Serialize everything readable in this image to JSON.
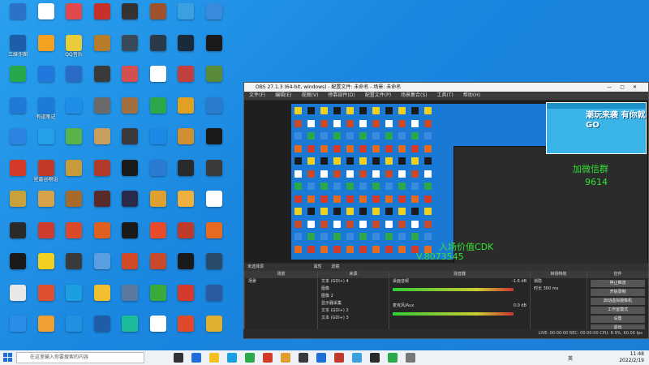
{
  "desktop": {
    "columns": [
      [
        [
          "",
          "#2b73c9"
        ],
        [
          "三维作图",
          "#1e5ea8"
        ],
        [
          "",
          "#27a84a"
        ],
        [
          "",
          "#1e7ad6"
        ],
        [
          "",
          "#2b84e0"
        ],
        [
          "",
          "#d43a2a"
        ],
        [
          "",
          "#c9a13a"
        ],
        [
          "",
          "#2a2a2a"
        ],
        [
          "",
          "#1a1a1a"
        ],
        [
          "",
          "#e8e8e8"
        ],
        [
          "",
          "#2b8ee6"
        ]
      ],
      [
        [
          "",
          "#ffffff"
        ],
        [
          "",
          "#f4a020"
        ],
        [
          "",
          "#2277dd"
        ],
        [
          "有道笔记",
          "#1c7cd5"
        ],
        [
          "",
          "#23a0e8"
        ],
        [
          "星露谷物语",
          "#c33a28"
        ],
        [
          "",
          "#d6a24a"
        ],
        [
          "",
          "#cf3b2c"
        ],
        [
          "",
          "#f2d020"
        ],
        [
          "",
          "#e05030"
        ],
        [
          "",
          "#f0a030"
        ]
      ],
      [
        [
          "",
          "#e0484c"
        ],
        [
          "QQ音乐",
          "#eacb3a"
        ],
        [
          "",
          "#2b6bc8"
        ],
        [
          "",
          "#1f8ee8"
        ],
        [
          "",
          "#5ab24a"
        ],
        [
          "",
          "#c89a3a"
        ],
        [
          "",
          "#a86a2a"
        ],
        [
          "",
          "#d94a2a"
        ],
        [
          "",
          "#3a3a3a"
        ],
        [
          "",
          "#1aa0e0"
        ],
        [
          "",
          "#2090e0"
        ]
      ],
      [
        [
          "",
          "#c8302a"
        ],
        [
          "",
          "#b67c2a"
        ],
        [
          "",
          "#3a3a3a"
        ],
        [
          "",
          "#6a6a6a"
        ],
        [
          "",
          "#c7a060"
        ],
        [
          "",
          "#b23a2a"
        ],
        [
          "",
          "#5a2a2a"
        ],
        [
          "",
          "#e06020"
        ],
        [
          "",
          "#5aa0e0"
        ],
        [
          "",
          "#f0c030"
        ],
        [
          "",
          "#1e5ea8"
        ]
      ],
      [
        [
          "",
          "#333"
        ],
        [
          "",
          "#3a4a5a"
        ],
        [
          "",
          "#d45050"
        ],
        [
          "",
          "#a07040"
        ],
        [
          "",
          "#3a3a3a"
        ],
        [
          "",
          "#1a1a1a"
        ],
        [
          "",
          "#2a2a4a"
        ],
        [
          "",
          "#1a1a1a"
        ],
        [
          "",
          "#d04a2a"
        ],
        [
          "",
          "#5a7aa0"
        ],
        [
          "",
          "#1abc9c"
        ]
      ],
      [
        [
          "",
          "#a0522d"
        ],
        [
          "",
          "#2a3a4a"
        ],
        [
          "",
          "#ffffff"
        ],
        [
          "",
          "#2aa84a"
        ],
        [
          "",
          "#1e88e5"
        ],
        [
          "",
          "#2a7ad0"
        ],
        [
          "",
          "#e0a030"
        ],
        [
          "",
          "#e84a2a"
        ],
        [
          "",
          "#c84a2a"
        ],
        [
          "",
          "#3aaa3a"
        ],
        [
          "",
          "#ffffff"
        ]
      ],
      [
        [
          "",
          "#3aa0e0"
        ],
        [
          "",
          "#1a2a3a"
        ],
        [
          "",
          "#c04040"
        ],
        [
          "",
          "#e0a020"
        ],
        [
          "",
          "#d09030"
        ],
        [
          "",
          "#2a2a2a"
        ],
        [
          "",
          "#f0b040"
        ],
        [
          "",
          "#c03a2a"
        ],
        [
          "",
          "#1a1a1a"
        ],
        [
          "",
          "#d63a2a"
        ],
        [
          "",
          "#e04a2a"
        ]
      ],
      [
        [
          "",
          "#3a8ae0"
        ],
        [
          "",
          "#1a1a1a"
        ],
        [
          "",
          "#5a8a3a"
        ],
        [
          "",
          "#2a7ad0"
        ],
        [
          "",
          "#1a1a1a"
        ],
        [
          "",
          "#3a3a3a"
        ],
        [
          "",
          "#fefefe"
        ],
        [
          "",
          "#e86a20"
        ],
        [
          "",
          "#2a4a6a"
        ],
        [
          "",
          "#2a5aa0"
        ],
        [
          "",
          "#e0b030"
        ]
      ]
    ]
  },
  "obs": {
    "title": "OBS 27.1.3 (64-bit, windows) - 配置文件: 未命名 - 场景: 未命名",
    "menu": [
      "文件(F)",
      "编辑(E)",
      "视图(V)",
      "停靠部件(D)",
      "配置文件(P)",
      "场景集合(S)",
      "工具(T)",
      "帮助(H)"
    ],
    "ad_top": "",
    "ad_text": "潮玩来袭 有你就GO",
    "overlay_top": "加微信群",
    "overlay_top2": "9614",
    "overlay_mid": "入场价值CDK",
    "overlay_mid2": "V.8073545",
    "not_selected": "未选择源",
    "props_label": "属性",
    "filters_label": "滤镜",
    "docks": {
      "scenes_title": "场景",
      "sources_title": "来源",
      "mixer_title": "混音器",
      "transition_title": "转场特效",
      "controls_title": "控件"
    },
    "scenes": [
      "场景"
    ],
    "sources": [
      "文本 (GDI+) 4",
      "图像",
      "图像 2",
      "显示器采集",
      "文本 (GDI+) 2",
      "文本 (GDI+) 3"
    ],
    "mixer": [
      "桌面音频",
      "麦克风/Aux"
    ],
    "mixer_db": [
      "-1.6 dB",
      "0.0 dB"
    ],
    "transition": {
      "type": "渐隐",
      "duration_label": "时长",
      "duration": "300 ms"
    },
    "controls": [
      "停止推流",
      "开始录制",
      "启动虚拟摄像机",
      "工作室模式",
      "设置",
      "退出"
    ],
    "status": "LIVE: 00:00:00   REC: 00:00:00   CPU: 8.9%, 60.00 fps"
  },
  "taskbar": {
    "search_placeholder": "在这里输入你要搜索的内容",
    "time": "11:48",
    "date": "2022/2/19",
    "ime": "英"
  }
}
